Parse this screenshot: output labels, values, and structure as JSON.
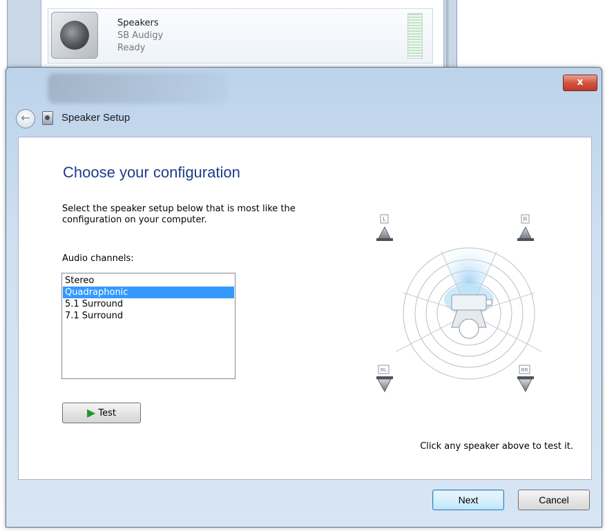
{
  "background_window": {
    "device": {
      "name": "Speakers",
      "driver": "SB Audigy",
      "status": "Ready"
    }
  },
  "dialog": {
    "title": "Speaker Setup",
    "close_glyph": "x",
    "back_glyph": "←"
  },
  "main": {
    "heading": "Choose your configuration",
    "intro": "Select the speaker setup below that is most like the configuration on your computer.",
    "channels_label": "Audio channels:",
    "channels": [
      "Stereo",
      "Quadraphonic",
      "5.1 Surround",
      "7.1 Surround"
    ],
    "selected_channel": "Quadraphonic",
    "test_button": "Test",
    "test_hint": "Click any speaker above to test it."
  },
  "speakers": {
    "front_left": "L",
    "front_right": "R",
    "rear_left": "RL",
    "rear_right": "RR"
  },
  "footer": {
    "next_label": "Next",
    "cancel_label": "Cancel"
  },
  "colors": {
    "selection": "#3399ff",
    "heading": "#1e3c8c",
    "close_button": "#c9412f"
  }
}
